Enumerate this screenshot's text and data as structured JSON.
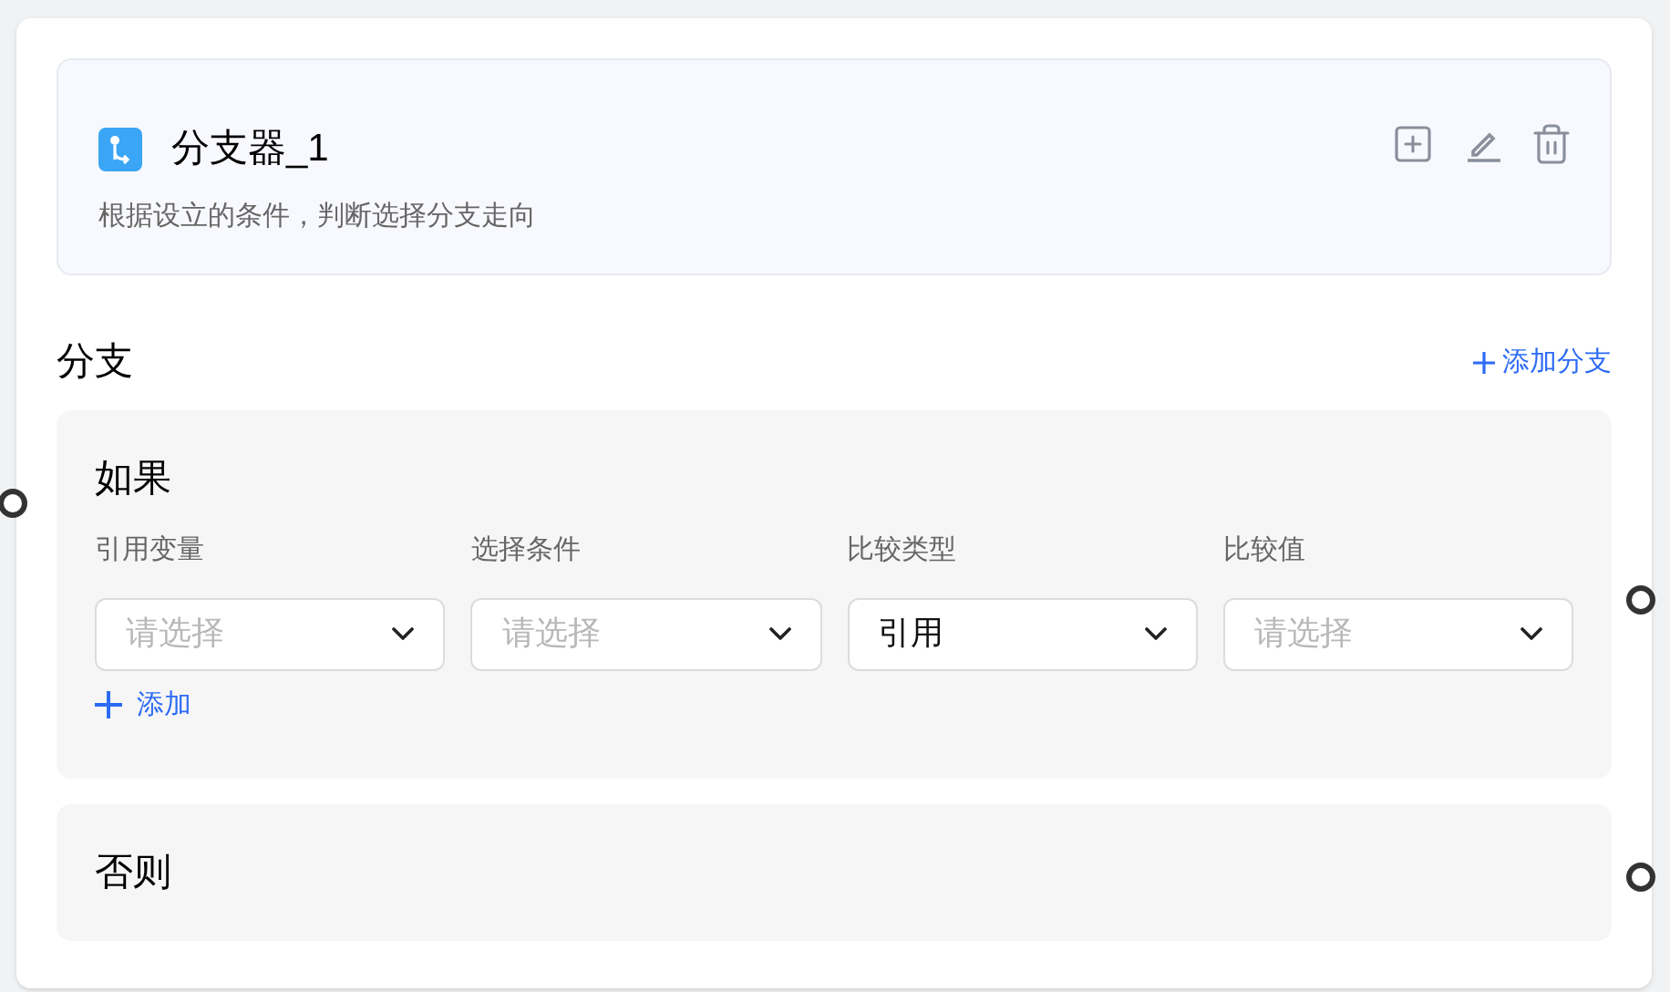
{
  "node": {
    "title": "分支器_1",
    "description": "根据设立的条件，判断选择分支走向"
  },
  "branches_section": {
    "title": "分支",
    "add_branch": "添加分支"
  },
  "if_block": {
    "title": "如果",
    "columns": [
      "引用变量",
      "选择条件",
      "比较类型",
      "比较值"
    ],
    "selects": [
      {
        "placeholder": "请选择"
      },
      {
        "placeholder": "请选择"
      },
      {
        "value": "引用"
      },
      {
        "placeholder": "请选择"
      }
    ],
    "add": "添加"
  },
  "else_block": {
    "title": "否则"
  }
}
